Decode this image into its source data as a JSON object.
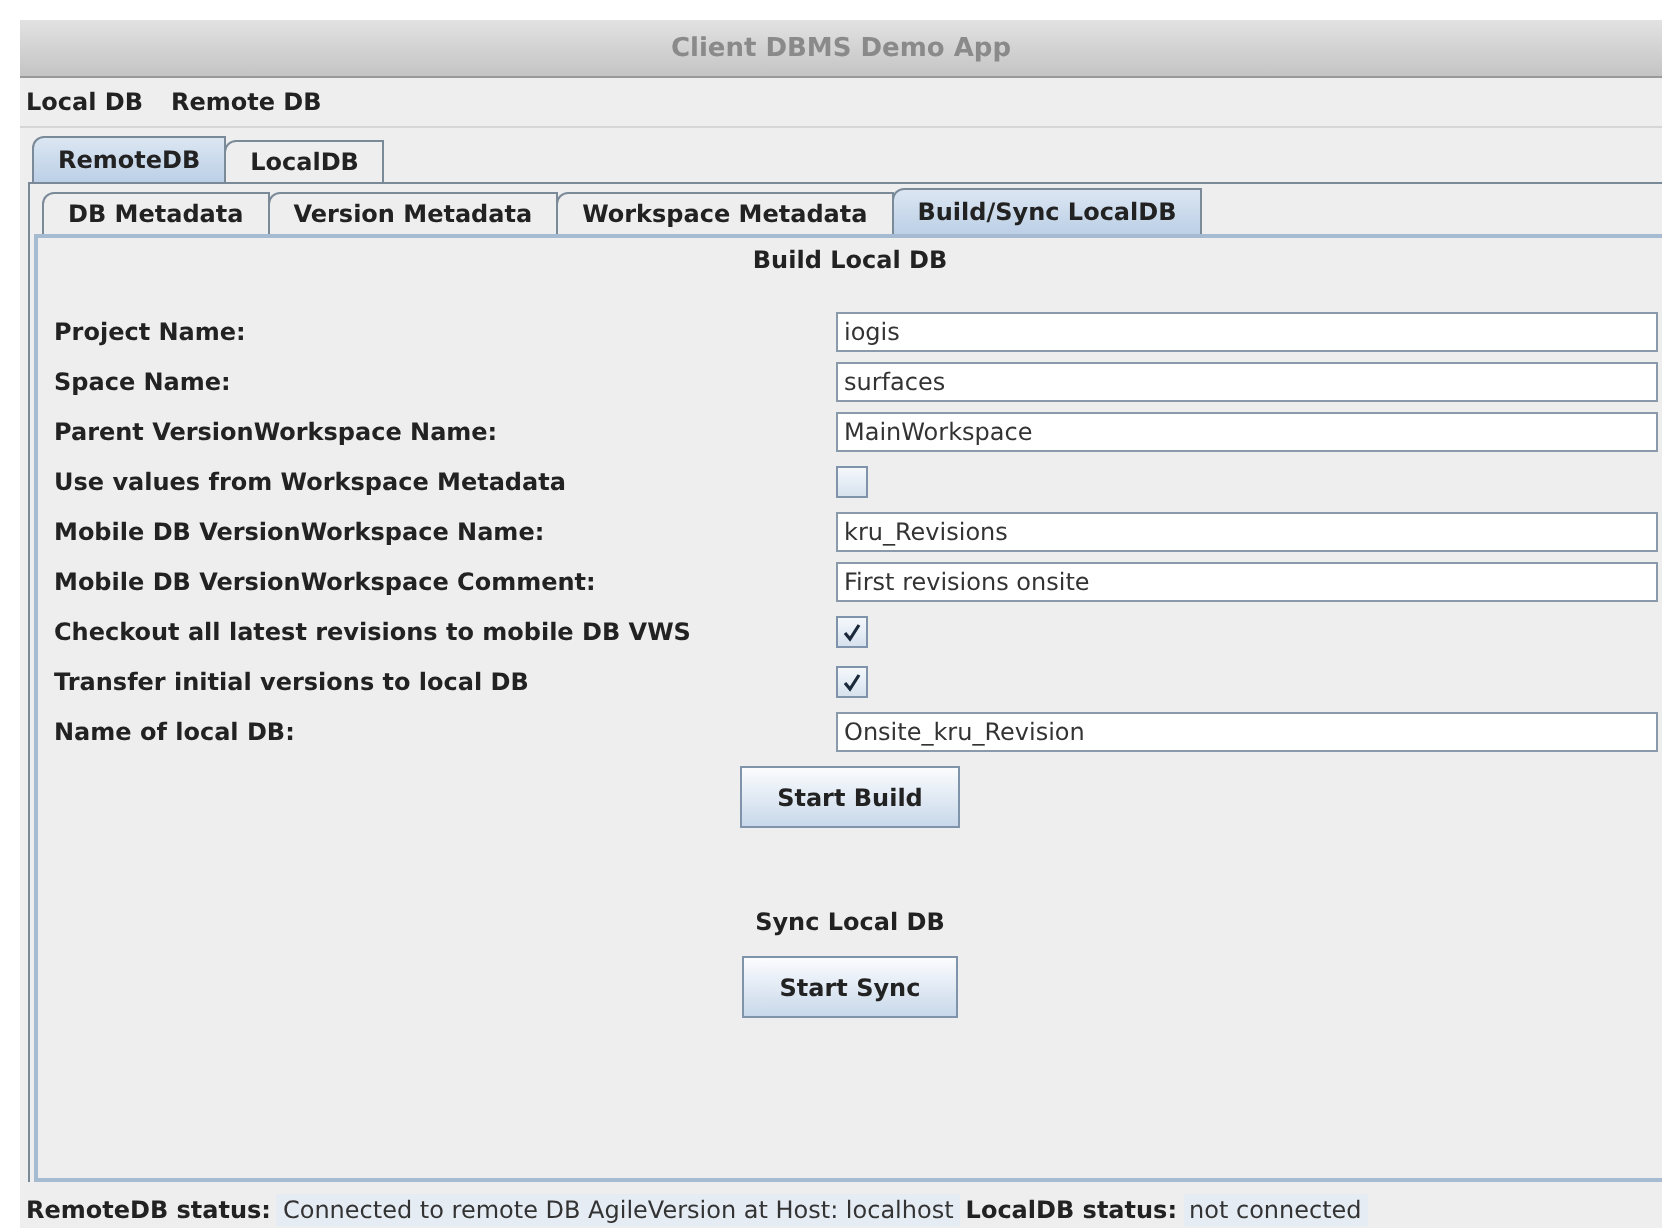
{
  "window": {
    "title": "Client DBMS Demo App"
  },
  "menu": [
    "Local DB",
    "Remote DB"
  ],
  "outer_tabs": [
    {
      "label": "RemoteDB",
      "selected": true
    },
    {
      "label": "LocalDB",
      "selected": false
    }
  ],
  "inner_tabs": [
    {
      "label": "DB Metadata",
      "selected": false
    },
    {
      "label": "Version Metadata",
      "selected": false
    },
    {
      "label": "Workspace Metadata",
      "selected": false
    },
    {
      "label": "Build/Sync LocalDB",
      "selected": true
    }
  ],
  "build_section": {
    "heading": "Build Local DB",
    "fields": [
      {
        "kind": "text",
        "label": "Project Name:",
        "value": "iogis"
      },
      {
        "kind": "text",
        "label": "Space Name:",
        "value": "surfaces"
      },
      {
        "kind": "text",
        "label": "Parent VersionWorkspace Name:",
        "value": "MainWorkspace"
      },
      {
        "kind": "checkbox",
        "label": "Use values from Workspace Metadata",
        "checked": false
      },
      {
        "kind": "text",
        "label": "Mobile DB VersionWorkspace Name:",
        "value": "kru_Revisions"
      },
      {
        "kind": "text",
        "label": "Mobile DB VersionWorkspace Comment:",
        "value": "First revisions onsite"
      },
      {
        "kind": "checkbox",
        "label": "Checkout all latest revisions to mobile DB VWS",
        "checked": true
      },
      {
        "kind": "checkbox",
        "label": "Transfer initial versions to local DB",
        "checked": true
      },
      {
        "kind": "text",
        "label": "Name of local DB:",
        "value": "Onsite_kru_Revision"
      }
    ],
    "button": "Start Build"
  },
  "sync_section": {
    "heading": "Sync Local DB",
    "button": "Start Sync"
  },
  "status_bar": [
    {
      "label": "RemoteDB status:",
      "value": "Connected to remote DB AgileVersion at Host: localhost"
    },
    {
      "label": "LocalDB status:",
      "value": "not connected"
    }
  ]
}
